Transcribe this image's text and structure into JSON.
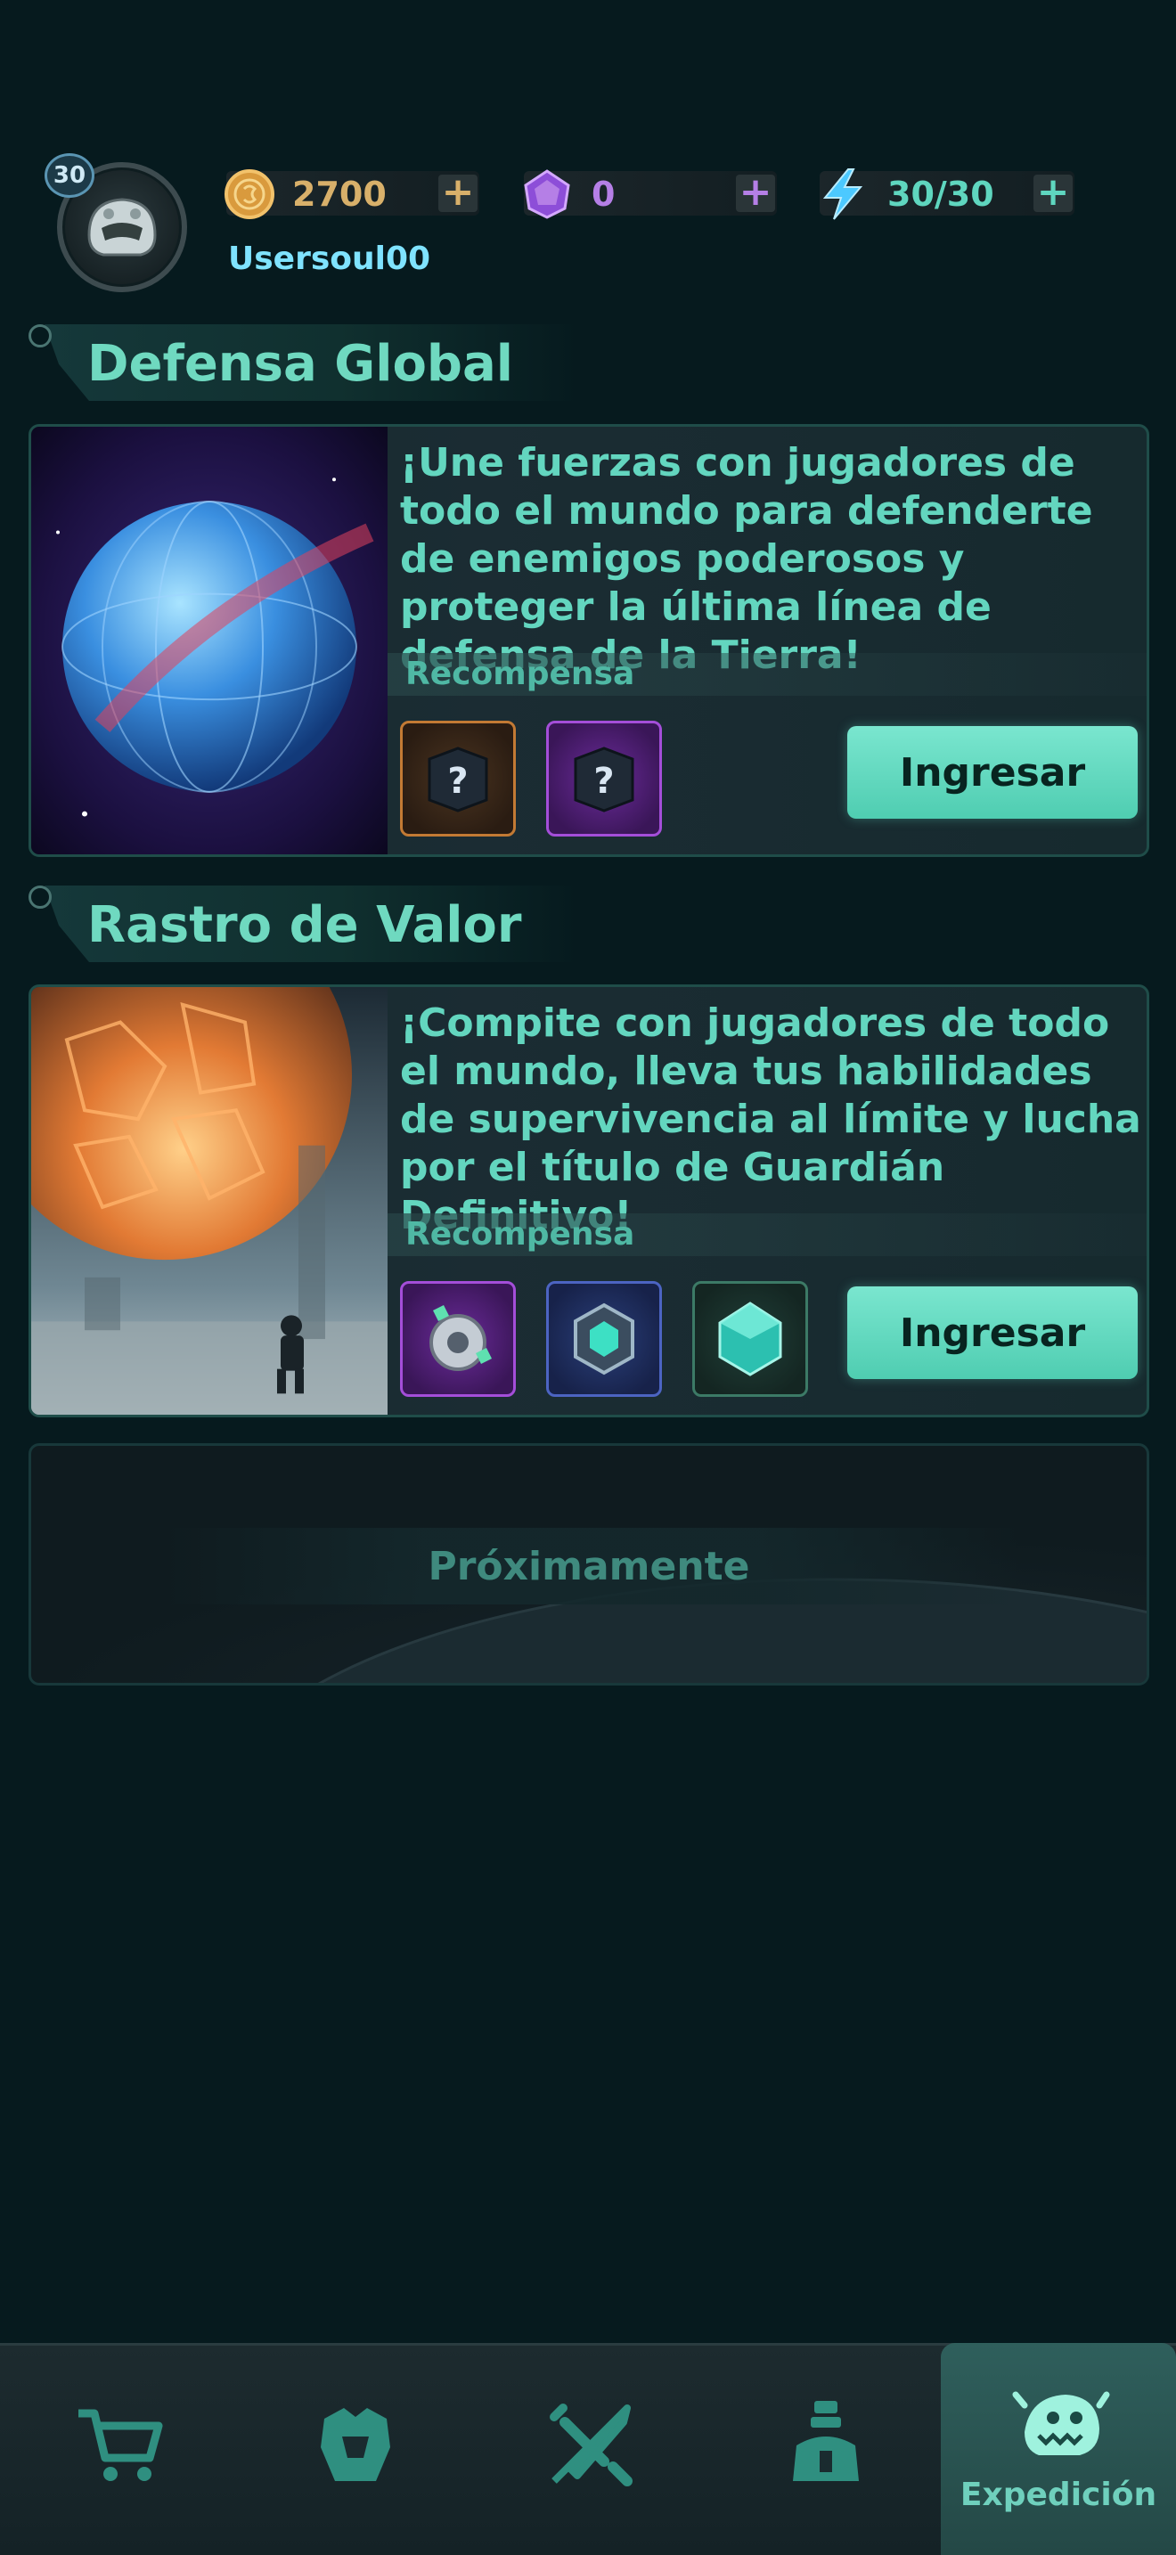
{
  "header": {
    "level": "30",
    "username": "Usersoul00",
    "resources": [
      {
        "name": "coins",
        "icon": "coin-icon",
        "value": "2700",
        "color": "#d8b06a"
      },
      {
        "name": "gems",
        "icon": "gem-icon",
        "value": "0",
        "color": "#b57fe6"
      },
      {
        "name": "energy",
        "icon": "lightning-icon",
        "value": "30/30",
        "color": "#5fd6bf"
      }
    ],
    "plus_label": "+"
  },
  "events": [
    {
      "title": "Defensa Global",
      "description": "¡Une fuerzas con jugadores de todo el mundo para defenderte de enemigos poderosos y proteger la última línea de defensa de la Tierra!",
      "reward_label": "Recompensa",
      "rewards": [
        "mystery-box-icon",
        "mystery-box-icon"
      ],
      "button_label": "Ingresar",
      "image": "globe-warning-icon"
    },
    {
      "title": "Rastro de Valor",
      "description": "¡Compite con jugadores de todo el mundo, lleva tus habilidades de supervivencia al límite y lucha por el título de Guardián Definitivo!",
      "reward_label": "Recompensa",
      "rewards": [
        "chip-icon",
        "core-icon",
        "crystal-icon"
      ],
      "button_label": "Ingresar",
      "image": "lava-planet-icon"
    }
  ],
  "coming_soon": {
    "label": "Próximamente"
  },
  "bottom_nav": {
    "items": [
      {
        "name": "shop",
        "icon": "cart-icon",
        "label": ""
      },
      {
        "name": "gear",
        "icon": "armor-icon",
        "label": ""
      },
      {
        "name": "battle",
        "icon": "crossed-swords-icon",
        "label": ""
      },
      {
        "name": "base",
        "icon": "tower-icon",
        "label": ""
      },
      {
        "name": "expedition",
        "icon": "monster-icon",
        "label": "Expedición"
      }
    ],
    "active": "expedition"
  }
}
